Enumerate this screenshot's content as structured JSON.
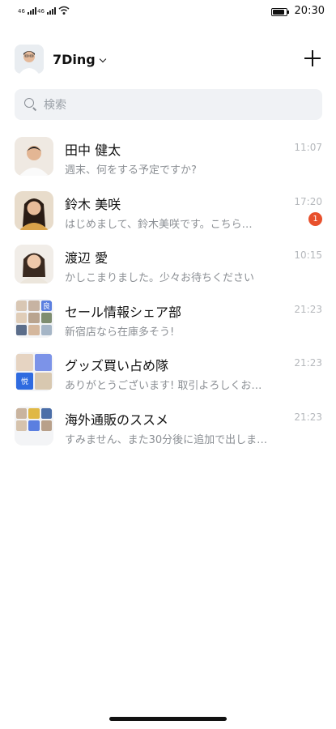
{
  "status_bar": {
    "signal1": "46",
    "signal2": "46",
    "time": "20:30"
  },
  "header": {
    "account_name": "7Ding"
  },
  "search": {
    "placeholder": "検索"
  },
  "chats": [
    {
      "name": "田中 健太",
      "preview": "週末、何をする予定ですか?",
      "time": "11:07",
      "badge": ""
    },
    {
      "name": "鈴木 美咲",
      "preview": "はじめまして、鈴木美咲です。こちら…",
      "time": "17:20",
      "badge": "1"
    },
    {
      "name": "渡辺 愛",
      "preview": "かしこまりました。少々お待ちください",
      "time": "10:15",
      "badge": ""
    },
    {
      "name": "セール情報シェア部",
      "preview": "新宿店なら在庫多そう!",
      "time": "21:23",
      "badge": "",
      "avatar_tile_text": "良"
    },
    {
      "name": "グッズ買い占め隊",
      "preview": "ありがとうございます! 取引よろしくお…",
      "time": "21:23",
      "badge": "",
      "avatar_tile_text": "悦"
    },
    {
      "name": "海外通販のススメ",
      "preview": "すみません、また30分後に追加で出しま…",
      "time": "21:23",
      "badge": ""
    }
  ],
  "colors": {
    "badge": "#e8502c",
    "search_bg": "#f0f2f5",
    "group_tile_blue": "#5b7fe0"
  }
}
